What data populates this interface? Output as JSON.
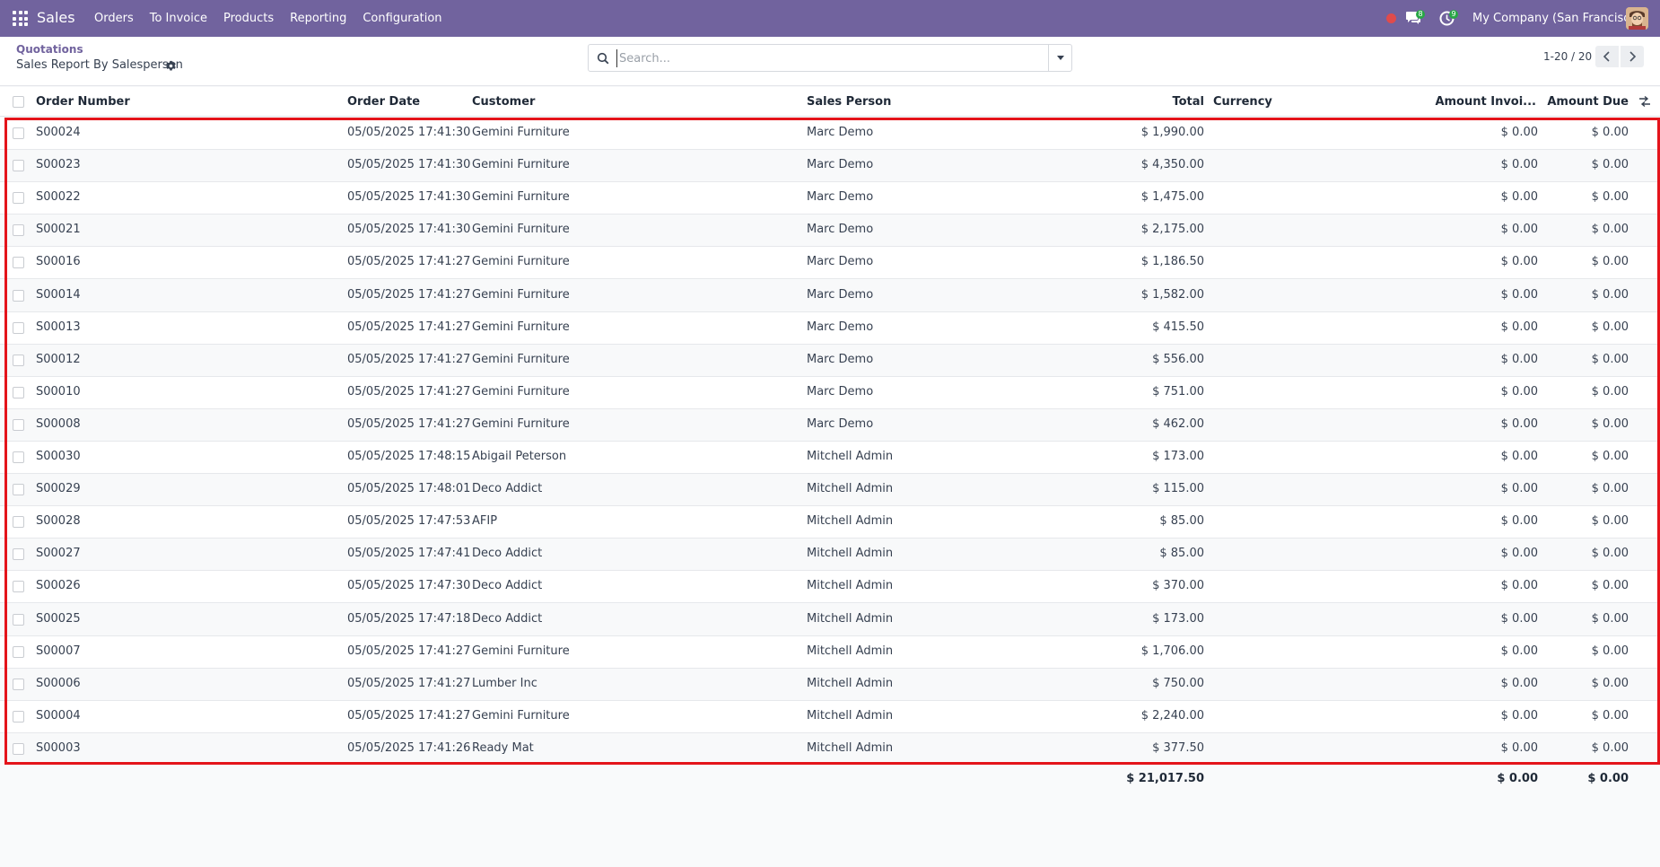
{
  "navbar": {
    "brand": "Sales",
    "menu": [
      "Orders",
      "To Invoice",
      "Products",
      "Reporting",
      "Configuration"
    ],
    "chat_count": "8",
    "activity_count": "9",
    "company": "My Company (San Francisco)",
    "accent": "#71639e"
  },
  "control_panel": {
    "breadcrumb": "Quotations",
    "title": "Sales Report By Salesperson",
    "search_placeholder": "Search...",
    "pager": "1-20 / 20"
  },
  "table": {
    "headers": {
      "order_number": "Order Number",
      "order_date": "Order Date",
      "customer": "Customer",
      "sales_person": "Sales Person",
      "total": "Total",
      "currency": "Currency",
      "amount_invoiced": "Amount Invoi...",
      "amount_due": "Amount Due"
    },
    "rows": [
      {
        "order": "S00024",
        "date": "05/05/2025 17:41:30",
        "customer": "Gemini Furniture",
        "sales_person": "Marc Demo",
        "total": "$ 1,990.00",
        "currency": "",
        "invoiced": "$ 0.00",
        "due": "$ 0.00"
      },
      {
        "order": "S00023",
        "date": "05/05/2025 17:41:30",
        "customer": "Gemini Furniture",
        "sales_person": "Marc Demo",
        "total": "$ 4,350.00",
        "currency": "",
        "invoiced": "$ 0.00",
        "due": "$ 0.00"
      },
      {
        "order": "S00022",
        "date": "05/05/2025 17:41:30",
        "customer": "Gemini Furniture",
        "sales_person": "Marc Demo",
        "total": "$ 1,475.00",
        "currency": "",
        "invoiced": "$ 0.00",
        "due": "$ 0.00"
      },
      {
        "order": "S00021",
        "date": "05/05/2025 17:41:30",
        "customer": "Gemini Furniture",
        "sales_person": "Marc Demo",
        "total": "$ 2,175.00",
        "currency": "",
        "invoiced": "$ 0.00",
        "due": "$ 0.00"
      },
      {
        "order": "S00016",
        "date": "05/05/2025 17:41:27",
        "customer": "Gemini Furniture",
        "sales_person": "Marc Demo",
        "total": "$ 1,186.50",
        "currency": "",
        "invoiced": "$ 0.00",
        "due": "$ 0.00"
      },
      {
        "order": "S00014",
        "date": "05/05/2025 17:41:27",
        "customer": "Gemini Furniture",
        "sales_person": "Marc Demo",
        "total": "$ 1,582.00",
        "currency": "",
        "invoiced": "$ 0.00",
        "due": "$ 0.00"
      },
      {
        "order": "S00013",
        "date": "05/05/2025 17:41:27",
        "customer": "Gemini Furniture",
        "sales_person": "Marc Demo",
        "total": "$ 415.50",
        "currency": "",
        "invoiced": "$ 0.00",
        "due": "$ 0.00"
      },
      {
        "order": "S00012",
        "date": "05/05/2025 17:41:27",
        "customer": "Gemini Furniture",
        "sales_person": "Marc Demo",
        "total": "$ 556.00",
        "currency": "",
        "invoiced": "$ 0.00",
        "due": "$ 0.00"
      },
      {
        "order": "S00010",
        "date": "05/05/2025 17:41:27",
        "customer": "Gemini Furniture",
        "sales_person": "Marc Demo",
        "total": "$ 751.00",
        "currency": "",
        "invoiced": "$ 0.00",
        "due": "$ 0.00"
      },
      {
        "order": "S00008",
        "date": "05/05/2025 17:41:27",
        "customer": "Gemini Furniture",
        "sales_person": "Marc Demo",
        "total": "$ 462.00",
        "currency": "",
        "invoiced": "$ 0.00",
        "due": "$ 0.00"
      },
      {
        "order": "S00030",
        "date": "05/05/2025 17:48:15",
        "customer": "Abigail Peterson",
        "sales_person": "Mitchell Admin",
        "total": "$ 173.00",
        "currency": "",
        "invoiced": "$ 0.00",
        "due": "$ 0.00"
      },
      {
        "order": "S00029",
        "date": "05/05/2025 17:48:01",
        "customer": "Deco Addict",
        "sales_person": "Mitchell Admin",
        "total": "$ 115.00",
        "currency": "",
        "invoiced": "$ 0.00",
        "due": "$ 0.00"
      },
      {
        "order": "S00028",
        "date": "05/05/2025 17:47:53",
        "customer": "AFIP",
        "sales_person": "Mitchell Admin",
        "total": "$ 85.00",
        "currency": "",
        "invoiced": "$ 0.00",
        "due": "$ 0.00"
      },
      {
        "order": "S00027",
        "date": "05/05/2025 17:47:41",
        "customer": "Deco Addict",
        "sales_person": "Mitchell Admin",
        "total": "$ 85.00",
        "currency": "",
        "invoiced": "$ 0.00",
        "due": "$ 0.00"
      },
      {
        "order": "S00026",
        "date": "05/05/2025 17:47:30",
        "customer": "Deco Addict",
        "sales_person": "Mitchell Admin",
        "total": "$ 370.00",
        "currency": "",
        "invoiced": "$ 0.00",
        "due": "$ 0.00"
      },
      {
        "order": "S00025",
        "date": "05/05/2025 17:47:18",
        "customer": "Deco Addict",
        "sales_person": "Mitchell Admin",
        "total": "$ 173.00",
        "currency": "",
        "invoiced": "$ 0.00",
        "due": "$ 0.00"
      },
      {
        "order": "S00007",
        "date": "05/05/2025 17:41:27",
        "customer": "Gemini Furniture",
        "sales_person": "Mitchell Admin",
        "total": "$ 1,706.00",
        "currency": "",
        "invoiced": "$ 0.00",
        "due": "$ 0.00"
      },
      {
        "order": "S00006",
        "date": "05/05/2025 17:41:27",
        "customer": "Lumber Inc",
        "sales_person": "Mitchell Admin",
        "total": "$ 750.00",
        "currency": "",
        "invoiced": "$ 0.00",
        "due": "$ 0.00"
      },
      {
        "order": "S00004",
        "date": "05/05/2025 17:41:27",
        "customer": "Gemini Furniture",
        "sales_person": "Mitchell Admin",
        "total": "$ 2,240.00",
        "currency": "",
        "invoiced": "$ 0.00",
        "due": "$ 0.00"
      },
      {
        "order": "S00003",
        "date": "05/05/2025 17:41:26",
        "customer": "Ready Mat",
        "sales_person": "Mitchell Admin",
        "total": "$ 377.50",
        "currency": "",
        "invoiced": "$ 0.00",
        "due": "$ 0.00"
      }
    ],
    "footer": {
      "total": "$ 21,017.50",
      "invoiced": "$ 0.00",
      "due": "$ 0.00"
    }
  },
  "highlight_color": "#e4141b"
}
